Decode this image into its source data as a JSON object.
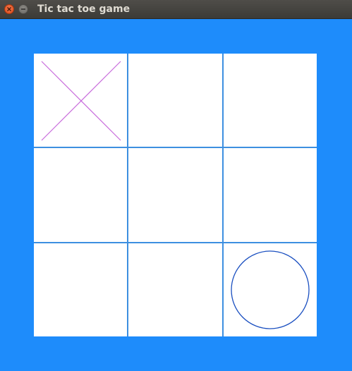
{
  "window": {
    "title": "Tic tac toe game",
    "controls": [
      "close-icon",
      "minimize-icon"
    ]
  },
  "colors": {
    "background": "#1e8cfb",
    "board": "#ffffff",
    "grid_lines": "#3d8fe0",
    "x_mark": "#c86bdc",
    "o_mark": "#1a4fc0"
  },
  "board": {
    "cells": [
      "X",
      "",
      "",
      "",
      "",
      "",
      "",
      "",
      "O"
    ]
  }
}
